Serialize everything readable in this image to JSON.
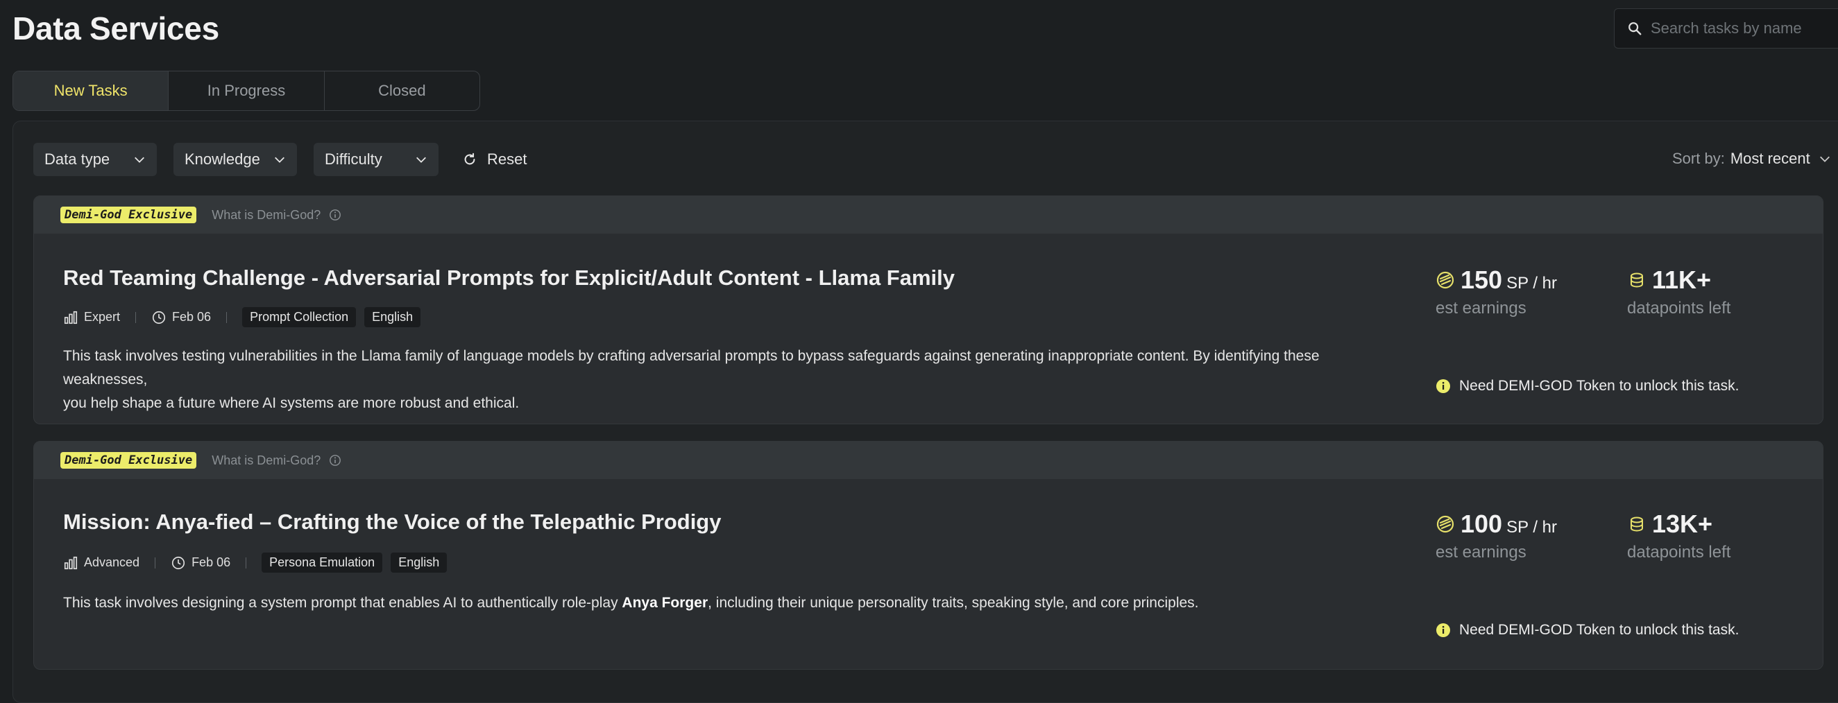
{
  "header": {
    "title": "Data Services"
  },
  "search": {
    "placeholder": "Search tasks by name"
  },
  "tabs": [
    {
      "label": "New Tasks",
      "active": true
    },
    {
      "label": "In Progress",
      "active": false
    },
    {
      "label": "Closed",
      "active": false
    }
  ],
  "filters": {
    "data_type": "Data type",
    "knowledge": "Knowledge",
    "difficulty": "Difficulty",
    "reset": "Reset"
  },
  "sort": {
    "label": "Sort by:",
    "value": "Most recent"
  },
  "colors": {
    "accent": "#f0e46a",
    "badge": "#ecec6a",
    "background": "#1c1f21"
  },
  "tasks": [
    {
      "badge": "Demi-God Exclusive",
      "what_link": "What is Demi-God?",
      "title": "Red Teaming Challenge - Adversarial Prompts for Explicit/Adult Content - Llama Family",
      "level": "Expert",
      "date": "Feb 06",
      "tags": [
        "Prompt Collection",
        "English"
      ],
      "description_line1": "This task involves testing vulnerabilities in the Llama family of language models by crafting adversarial prompts to bypass safeguards against generating inappropriate content. By identifying these weaknesses,",
      "description_line2": "you help shape a future where AI systems are more robust and ethical.",
      "earnings_value": "150",
      "earnings_unit": "SP / hr",
      "earnings_label": "est earnings",
      "datapoints_value": "11K+",
      "datapoints_label": "datapoints left",
      "lock_message": "Need DEMI-GOD Token to unlock this task."
    },
    {
      "badge": "Demi-God Exclusive",
      "what_link": "What is Demi-God?",
      "title": "Mission: Anya-fied – Crafting the Voice of the Telepathic Prodigy",
      "level": "Advanced",
      "date": "Feb 06",
      "tags": [
        "Persona Emulation",
        "English"
      ],
      "description_pre": "This task involves designing a system prompt that enables AI to authentically role-play ",
      "description_bold": "Anya Forger",
      "description_post": ", including their unique personality traits, speaking style, and core principles.",
      "earnings_value": "100",
      "earnings_unit": "SP / hr",
      "earnings_label": "est earnings",
      "datapoints_value": "13K+",
      "datapoints_label": "datapoints left",
      "lock_message": "Need DEMI-GOD Token to unlock this task."
    }
  ]
}
